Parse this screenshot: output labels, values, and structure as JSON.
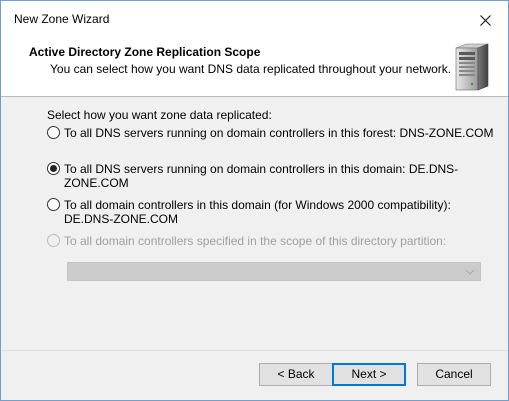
{
  "window": {
    "title": "New Zone Wizard"
  },
  "header": {
    "title": "Active Directory Zone Replication Scope",
    "subtitle": "You can select how you want DNS data replicated throughout your network."
  },
  "content": {
    "prompt": "Select how you want zone data replicated:",
    "options": [
      {
        "label": "To all DNS servers running on domain controllers in this forest: DNS-ZONE.COM",
        "selected": false,
        "enabled": true
      },
      {
        "label": "To all DNS servers running on domain controllers in this domain: DE.DNS-ZONE.COM",
        "selected": true,
        "enabled": true
      },
      {
        "label": "To all domain controllers in this domain (for Windows 2000 compatibility):",
        "label_line2": "DE.DNS-ZONE.COM",
        "selected": false,
        "enabled": true
      },
      {
        "label": "To all domain controllers specified in the scope of this directory partition:",
        "selected": false,
        "enabled": false
      }
    ],
    "partition_dropdown": {
      "value": "",
      "enabled": false
    }
  },
  "buttons": {
    "back": "< Back",
    "next": "Next >",
    "cancel": "Cancel"
  },
  "colors": {
    "accent": "#0078d7",
    "disabled_text": "#a0a0a0"
  }
}
